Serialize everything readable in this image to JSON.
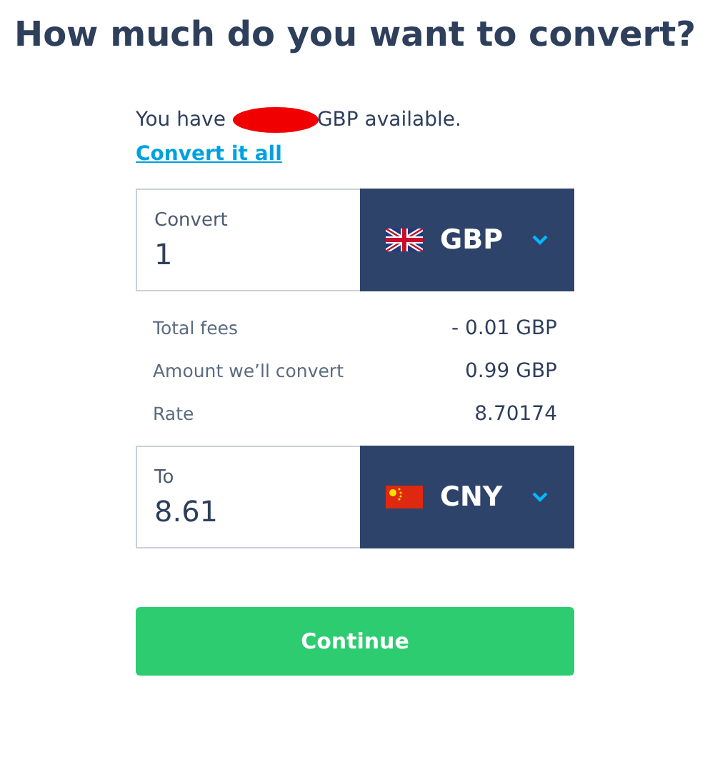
{
  "title": "How much do you want to convert?",
  "balance": {
    "prefix": "You have",
    "suffix": "GBP available.",
    "redacted": true
  },
  "convert_all_link": "Convert it all",
  "source": {
    "label": "Convert",
    "value": "1",
    "currency": "GBP",
    "kind": "uk"
  },
  "fees": [
    {
      "label": "Total fees",
      "value": "- 0.01 GBP"
    },
    {
      "label": "Amount we’ll convert",
      "value": "0.99 GBP"
    },
    {
      "label": "Rate",
      "value": "8.70174"
    }
  ],
  "target": {
    "label": "To",
    "value": "8.61",
    "currency": "CNY",
    "kind": "cn"
  },
  "continue_button": "Continue"
}
